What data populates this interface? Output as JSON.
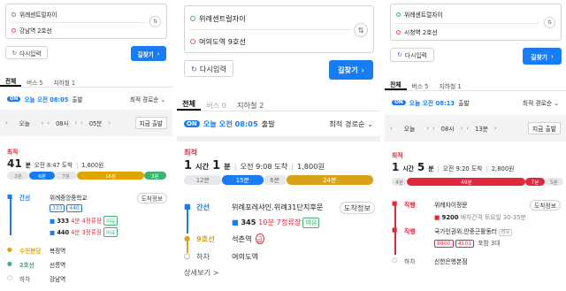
{
  "p1": {
    "origin": "위례센트럴자이",
    "destination": "강남역 2호선",
    "reset": "다시입력",
    "go": "길찾기",
    "tabs": [
      "전체",
      "버스 5",
      "지하철 1"
    ],
    "on": "ON",
    "today": "오늘 오전 08:05",
    "depart": "출발",
    "sort": "최적 경로순",
    "day": "오늘",
    "hour": "08시",
    "minute": "05분",
    "now": "지금 출발",
    "label": "최적",
    "dur_num": "41",
    "dur_unit": "분",
    "arrive": "오전 8:47 도착",
    "fare": "1,600원",
    "segs": [
      "3분",
      "6분",
      "7분",
      "16분",
      "3분"
    ],
    "leg1_mode": "간선",
    "leg1_stop": "위례중앙중학교",
    "leg1_chips": [
      "333",
      "440"
    ],
    "leg1_btn": "도착정보",
    "leg1_bus1": "333",
    "leg1_bus1_info": "4분 4정류장",
    "leg1_bus2": "440",
    "leg1_bus2_info": "4분 3정류장",
    "badge": "여유",
    "leg2_mode": "수인분당",
    "leg2_stop": "복정역",
    "leg3_mode": "2호선",
    "leg3_stop": "선릉역",
    "leg4_mode": "하차",
    "leg4_stop": "강남역"
  },
  "p2": {
    "origin": "위례센트럴자이",
    "destination": "여의도역 9호선",
    "reset": "다시입력",
    "go": "길찾기",
    "tabs": [
      "전체",
      "버스 0",
      "지하철 2"
    ],
    "on": "ON",
    "today": "오늘 오전 08:05",
    "depart": "출발",
    "sort": "최적 경로순",
    "label": "최적",
    "dur_h": "1",
    "dur_h_unit": "시간",
    "dur_m": "1",
    "dur_m_unit": "분",
    "arrive": "오전 9:08 도착",
    "fare": "1,800원",
    "segs": [
      "12분",
      "15분",
      "6분",
      "24분"
    ],
    "leg1_mode": "간선",
    "leg1_stop": "위례포레샤인.위례31단지후문",
    "leg1_btn": "도착정보",
    "leg1_bus": "345",
    "leg1_info": "10분 7정류장",
    "badge": "여유",
    "leg2_mode": "9호선",
    "leg2_stop": "석촌역",
    "leg2_mark": "급",
    "leg3_mode": "하차",
    "leg3_stop": "여의도역",
    "more": "상세보기 >"
  },
  "p3": {
    "origin": "위례센트럴자이",
    "destination": "시청역 2호선",
    "reset": "다시입력",
    "go": "길찾기",
    "tabs": [
      "전체",
      "버스 5",
      "지하철 1"
    ],
    "on": "ON",
    "today": "오늘 오전 08:13",
    "depart": "출발",
    "sort": "최적 경로순",
    "day": "오늘",
    "hour": "08시",
    "minute": "13분",
    "now": "지금 출발",
    "label": "최적",
    "dur_h": "1",
    "dur_h_unit": "시간",
    "dur_m": "5",
    "dur_m_unit": "분",
    "arrive": "오전 9:20 도착",
    "fare": "2,800원",
    "segs": [
      "4분",
      "49분",
      "7분",
      "5분"
    ],
    "leg1_mode": "직행",
    "leg1_stop": "위례자이정문",
    "leg1_btn": "도착정보",
    "leg1_bus": "9200",
    "leg1_info": "배차간격 토요일 30-35분",
    "leg2_mode": "직행",
    "leg2_stop": "국가인권위.안중근활동터",
    "leg2_tag": "경유",
    "leg2_chips": [
      "8800",
      "4101"
    ],
    "leg2_extra": "포함 3대",
    "leg3_mode": "하차",
    "leg3_stop": "신한은행본점"
  },
  "colors": {
    "blue": "#1a7cf2",
    "red": "#e0283c",
    "gold": "#d9a21b",
    "green": "#3cb371",
    "line2": "#3cb371",
    "bundang": "#e0a400",
    "line9": "#bd9a3a"
  }
}
